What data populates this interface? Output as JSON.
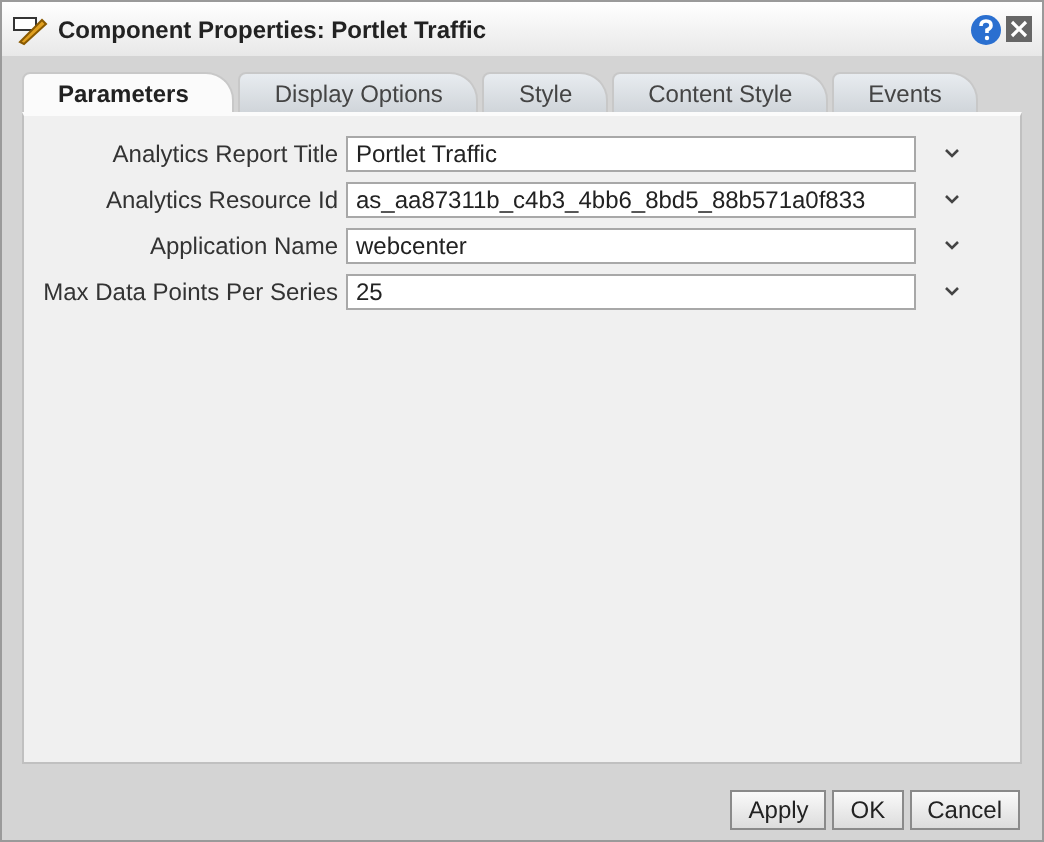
{
  "window": {
    "title": "Component Properties: Portlet Traffic"
  },
  "tabs": [
    {
      "label": "Parameters",
      "selected": true
    },
    {
      "label": "Display Options",
      "selected": false
    },
    {
      "label": "Style",
      "selected": false
    },
    {
      "label": "Content Style",
      "selected": false
    },
    {
      "label": "Events",
      "selected": false
    }
  ],
  "fields": [
    {
      "label": "Analytics Report Title",
      "value": "Portlet Traffic"
    },
    {
      "label": "Analytics Resource Id",
      "value": "as_aa87311b_c4b3_4bb6_8bd5_88b571a0f833"
    },
    {
      "label": "Application Name",
      "value": "webcenter"
    },
    {
      "label": "Max Data Points Per Series",
      "value": "25"
    }
  ],
  "buttons": [
    "Apply",
    "OK",
    "Cancel"
  ]
}
